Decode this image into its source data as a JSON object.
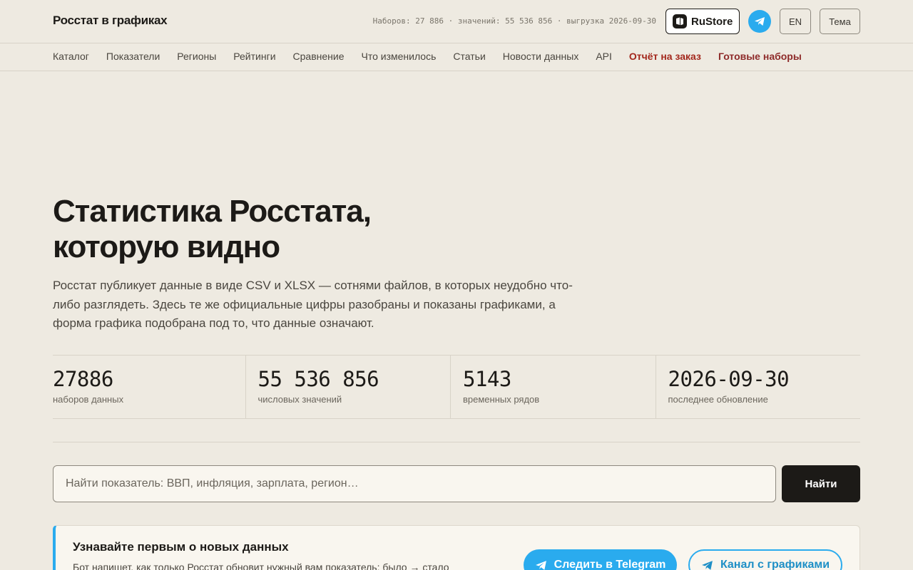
{
  "header": {
    "brand": "Росстат в графиках",
    "stats_line": "Наборов: 27 886 · значений: 55 536 856 · выгрузка 2026-09-30",
    "rustore_label": "RuStore",
    "lang_label": "EN",
    "theme_label": "Тема"
  },
  "nav": {
    "items": [
      {
        "label": "Каталог"
      },
      {
        "label": "Показатели"
      },
      {
        "label": "Регионы"
      },
      {
        "label": "Рейтинги"
      },
      {
        "label": "Сравнение"
      },
      {
        "label": "Что изменилось"
      },
      {
        "label": "Статьи"
      },
      {
        "label": "Новости данных"
      },
      {
        "label": "API"
      },
      {
        "label": "Отчёт на заказ"
      },
      {
        "label": "Готовые наборы"
      }
    ]
  },
  "hero": {
    "title_line1": "Статистика Росстата,",
    "title_line2": "которую видно",
    "lead": "Росстат публикует данные в виде CSV и XLSX — сотнями файлов, в которых неудобно что-либо разглядеть. Здесь те же официальные цифры разобраны и показаны графиками, а форма графика подобрана под то, что данные означают."
  },
  "stats": [
    {
      "value": "27886",
      "label": "наборов данных"
    },
    {
      "value": "55 536 856",
      "label": "числовых значений"
    },
    {
      "value": "5143",
      "label": "временных рядов"
    },
    {
      "value": "2026-09-30",
      "label": "последнее обновление"
    }
  ],
  "search": {
    "placeholder": "Найти показатель: ВВП, инфляция, зарплата, регион…",
    "button_label": "Найти"
  },
  "promo": {
    "title": "Узнавайте первым о новых данных",
    "text": "Бот напишет, как только Росстат обновит нужный вам показатель: было → стало",
    "follow_label": "Следить в Telegram",
    "channel_label": "Канал с графиками"
  },
  "colors": {
    "background": "#eeeae1",
    "accent_red": "#a3281d",
    "telegram_blue": "#2aabee",
    "button_dark": "#1c1a17"
  }
}
